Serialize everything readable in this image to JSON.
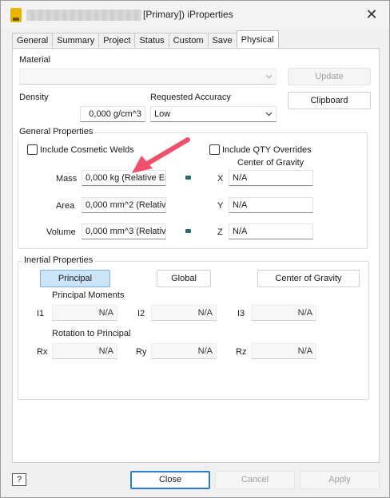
{
  "window": {
    "title": "[Primary]) iProperties",
    "close_glyph": "✕"
  },
  "tabs": [
    "General",
    "Summary",
    "Project",
    "Status",
    "Custom",
    "Save",
    "Physical"
  ],
  "active_tab": "Physical",
  "material": {
    "label": "Material",
    "value": "",
    "update_label": "Update"
  },
  "density": {
    "label": "Density",
    "value": "0,000 g/cm^3"
  },
  "accuracy": {
    "label": "Requested Accuracy",
    "value": "Low"
  },
  "clipboard_label": "Clipboard",
  "general_properties": {
    "caption": "General Properties",
    "include_cosmetic_welds": "Include Cosmetic Welds",
    "include_qty_overrides": "Include QTY Overrides",
    "center_of_gravity_caption": "Center of Gravity",
    "mass": {
      "label": "Mass",
      "value": "0,000 kg (Relative Err"
    },
    "area": {
      "label": "Area",
      "value": "0,000 mm^2 (Relative"
    },
    "volume": {
      "label": "Volume",
      "value": "0,000 mm^3 (Relativ"
    },
    "x": {
      "label": "X",
      "value": "N/A"
    },
    "y": {
      "label": "Y",
      "value": "N/A"
    },
    "z": {
      "label": "Z",
      "value": "N/A"
    }
  },
  "inertial_properties": {
    "caption": "Inertial Properties",
    "principal_btn": "Principal",
    "global_btn": "Global",
    "cog_btn": "Center of Gravity",
    "principal_moments": "Principal Moments",
    "i1": {
      "label": "I1",
      "value": "N/A"
    },
    "i2": {
      "label": "I2",
      "value": "N/A"
    },
    "i3": {
      "label": "I3",
      "value": "N/A"
    },
    "rotation_to_principal": "Rotation to Principal",
    "rx": {
      "label": "Rx",
      "value": "N/A"
    },
    "ry": {
      "label": "Ry",
      "value": "N/A"
    },
    "rz": {
      "label": "Rz",
      "value": "N/A"
    }
  },
  "footer": {
    "help_glyph": "?",
    "close": "Close",
    "cancel": "Cancel",
    "apply": "Apply"
  },
  "colors": {
    "annotation_arrow": "#f0506e",
    "selected_button": "#cce4f7"
  },
  "icons": [
    "app-icon",
    "close-icon",
    "help-icon",
    "dropdown-chevron-icon",
    "annotation-arrow"
  ]
}
